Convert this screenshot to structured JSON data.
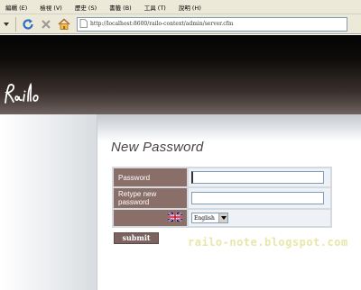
{
  "browser": {
    "menu": [
      "編輯 (E)",
      "檢視 (V)",
      "歷史 (S)",
      "書籤 (B)",
      "工具 (T)",
      "說明 (H)"
    ],
    "address": "http://localhost:8600/railo-context/admin/server.cfm"
  },
  "page": {
    "title": "New Password",
    "form": {
      "password_label": "Password",
      "password_value": "",
      "retype_label": "Retype new password",
      "retype_value": "",
      "language_selected": "English",
      "submit_label": "submit"
    }
  },
  "logo_text": "Railo",
  "watermark": "railo-note.blogspot.com",
  "colors": {
    "label_bg": "#8a6f69",
    "button_bg": "#7b6460",
    "header_dark": "#040404",
    "field_bg": "#eef2f6"
  }
}
